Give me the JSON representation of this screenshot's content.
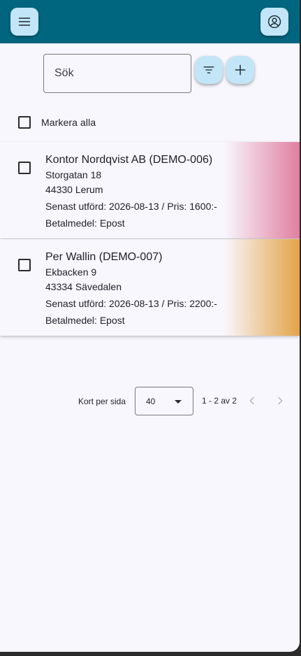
{
  "header": {
    "menu_icon": "menu-icon",
    "account_icon": "account-circle-icon",
    "background_color": "#006680",
    "button_color": "#c2e6f8"
  },
  "search": {
    "placeholder": "Sök",
    "value": "",
    "filter_icon": "filter-list-icon",
    "add_icon": "add-icon"
  },
  "select_all": {
    "label": "Markera alla",
    "checked": false
  },
  "cards": [
    {
      "title": "Kontor Nordqvist AB (DEMO-006)",
      "street": "Storgatan 18",
      "postal": "44330 Lerum",
      "last_done": "Senast utförd: 2026-08-13 / Pris: 1600:-",
      "payment": "Betalmedel: Epost",
      "accent_color": "#e07fa0",
      "checked": false
    },
    {
      "title": "Per Wallin (DEMO-007)",
      "street": "Ekbacken 9",
      "postal": "43334 Sävedalen",
      "last_done": "Senast utförd: 2026-08-13 / Pris: 2200:-",
      "payment": "Betalmedel: Epost",
      "accent_color": "#e3a347",
      "checked": false
    }
  ],
  "paginator": {
    "items_per_page_label": "Kort per sida",
    "page_size": "40",
    "range_label": "1 - 2 av 2",
    "prev_icon": "chevron-left-icon",
    "next_icon": "chevron-right-icon"
  }
}
